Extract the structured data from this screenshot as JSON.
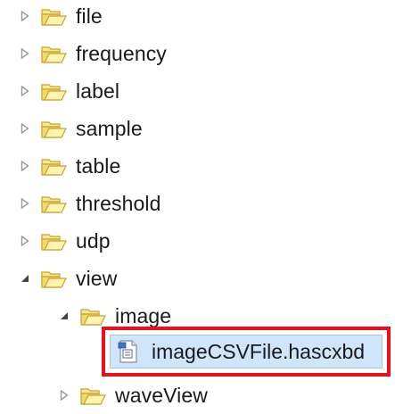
{
  "tree": {
    "items": [
      {
        "label": "file",
        "expanded": false,
        "icon": "folder-icon"
      },
      {
        "label": "frequency",
        "expanded": false,
        "icon": "folder-icon"
      },
      {
        "label": "label",
        "expanded": false,
        "icon": "folder-icon"
      },
      {
        "label": "sample",
        "expanded": false,
        "icon": "folder-icon"
      },
      {
        "label": "table",
        "expanded": false,
        "icon": "folder-icon"
      },
      {
        "label": "threshold",
        "expanded": false,
        "icon": "folder-icon"
      },
      {
        "label": "udp",
        "expanded": false,
        "icon": "folder-icon"
      },
      {
        "label": "view",
        "expanded": true,
        "icon": "folder-icon"
      },
      {
        "label": "image",
        "expanded": true,
        "icon": "folder-icon"
      },
      {
        "label": "imageCSVFile.hascxbd",
        "selected": true,
        "highlighted": true,
        "icon": "hascxbd-file-icon"
      },
      {
        "label": "waveView",
        "expanded": false,
        "icon": "folder-icon"
      }
    ]
  },
  "colors": {
    "selection_fill": "#cfe5fb",
    "highlight_border": "#e8121f",
    "folder_fill": "#f6e98e",
    "folder_stroke": "#c8a231"
  }
}
